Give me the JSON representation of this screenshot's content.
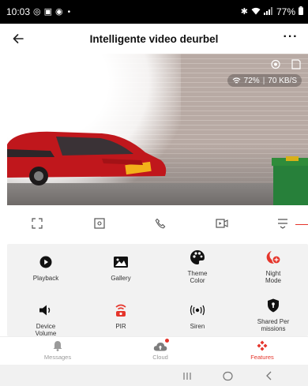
{
  "status_bar": {
    "time": "10:03",
    "battery": "77%"
  },
  "header": {
    "title": "Intelligente video deurbel",
    "more_label": "···"
  },
  "video": {
    "signal": "72%",
    "bitrate": "70 KB/S"
  },
  "toolbar": {
    "buttons": [
      "fullscreen-icon",
      "screenshot-icon",
      "talk-icon",
      "record-icon",
      "quality-icon"
    ]
  },
  "features": {
    "items": [
      {
        "label": "Playback",
        "icon": "playback-icon"
      },
      {
        "label": "Gallery",
        "icon": "gallery-icon"
      },
      {
        "label": "Theme Color",
        "icon": "palette-icon"
      },
      {
        "label": "Night Mode",
        "icon": "night-mode-icon"
      },
      {
        "label": "Device Volume",
        "icon": "volume-icon"
      },
      {
        "label": "PIR",
        "icon": "pir-icon"
      },
      {
        "label": "Siren",
        "icon": "siren-icon"
      },
      {
        "label": "Shared Per missions",
        "icon": "shield-icon"
      }
    ]
  },
  "bottom_nav": {
    "items": [
      {
        "label": "Messages",
        "state": "inactive"
      },
      {
        "label": "Cloud",
        "state": "inactive"
      },
      {
        "label": "Features",
        "state": "active"
      }
    ]
  },
  "colors": {
    "accent": "#e5352b",
    "live": "#3bb54a",
    "panel": "#f2f2f2"
  }
}
